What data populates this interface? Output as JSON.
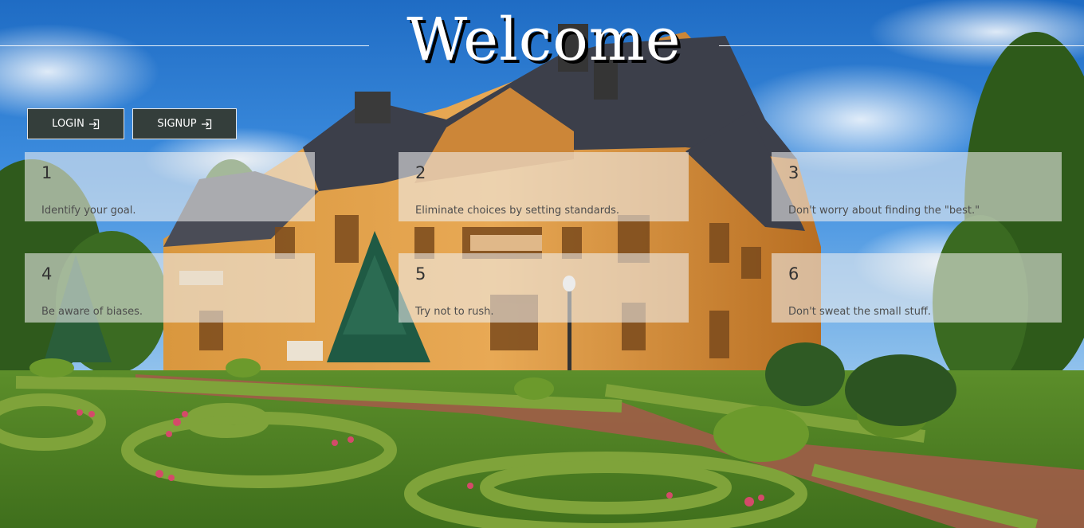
{
  "header": {
    "title": "Welcome"
  },
  "actions": {
    "login_label": "LOGIN",
    "signup_label": "SIGNUP",
    "icon": "sign-in-icon"
  },
  "tips": [
    {
      "number": "1",
      "text": "Identify your goal."
    },
    {
      "number": "2",
      "text": "Eliminate choices by setting standards."
    },
    {
      "number": "3",
      "text": "Don't worry about finding the \"best.\""
    },
    {
      "number": "4",
      "text": "Be aware of biases."
    },
    {
      "number": "5",
      "text": "Try not to rush."
    },
    {
      "number": "6",
      "text": "Don't sweat the small stuff."
    }
  ],
  "colors": {
    "button_bg": "#343e3b",
    "card_bg": "rgba(240,240,240,0.58)",
    "title_color": "#ffffff"
  }
}
